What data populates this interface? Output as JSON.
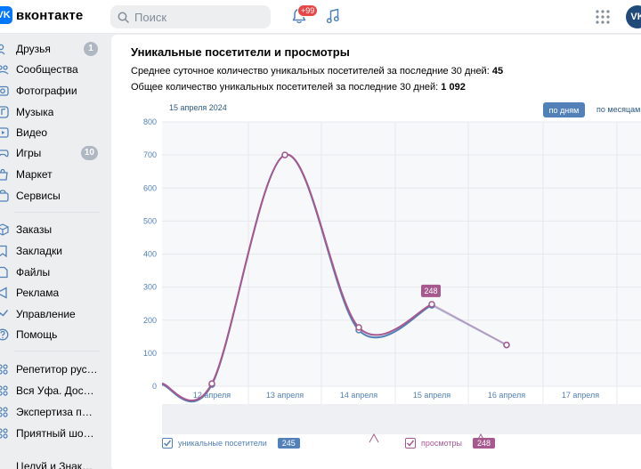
{
  "header": {
    "logo_mark": "VK",
    "logo_text": "вконтакте",
    "search_placeholder": "Поиск",
    "notification_count": "+99",
    "avatar_initials": "VK"
  },
  "sidebar": {
    "items": [
      {
        "label": "Друзья",
        "icon": "friends-icon",
        "count": "1"
      },
      {
        "label": "Сообщества",
        "icon": "communities-icon"
      },
      {
        "label": "Фотографии",
        "icon": "photos-icon"
      },
      {
        "label": "Музыка",
        "icon": "music-icon"
      },
      {
        "label": "Видео",
        "icon": "video-icon"
      },
      {
        "label": "Игры",
        "icon": "games-icon",
        "count": "10"
      },
      {
        "label": "Маркет",
        "icon": "market-icon"
      },
      {
        "label": "Сервисы",
        "icon": "services-icon"
      },
      {
        "label": "Заказы",
        "icon": "orders-icon"
      },
      {
        "label": "Закладки",
        "icon": "bookmarks-icon"
      },
      {
        "label": "Файлы",
        "icon": "files-icon"
      },
      {
        "label": "Реклама",
        "icon": "ads-icon"
      },
      {
        "label": "Управление",
        "icon": "management-icon"
      },
      {
        "label": "Помощь",
        "icon": "help-icon"
      },
      {
        "label": "Репетитор русско...",
        "icon": "app-icon"
      },
      {
        "label": "Вся Уфа. Доска бе...",
        "icon": "app-icon"
      },
      {
        "label": "Экспертиза почер...",
        "icon": "app-icon"
      },
      {
        "label": "Приятный шопинг...",
        "icon": "app-icon"
      },
      {
        "label": "Целуй и Знакомься",
        "icon": "app-icon"
      }
    ]
  },
  "main": {
    "title": "Уникальные посетители и просмотры",
    "stat1_text": "Среднее суточное количество уникальных посетителей за последние 30 дней: ",
    "stat1_value": "45",
    "stat2_text": "Общее количество уникальных посетителей за последние 30 дней: ",
    "stat2_value": "1 092",
    "selected_date": "15 апреля 2024",
    "btn_days": "по дням",
    "btn_months": "по месяцам",
    "tooltip_value": "248",
    "legend": [
      {
        "label": "уникальные посетители",
        "badge": "245",
        "color": "#5181b8"
      },
      {
        "label": "просмотры",
        "badge": "248",
        "color": "#a6588f"
      }
    ]
  },
  "chart_data": {
    "type": "line",
    "ylim": [
      0,
      800
    ],
    "yticks": [
      "0",
      "100",
      "200",
      "300",
      "400",
      "500",
      "600",
      "700",
      "800"
    ],
    "xticks": [
      "12 апреля",
      "13 апреля",
      "14 апреля",
      "15 апреля",
      "16 апреля",
      "17 апреля"
    ],
    "grid": true,
    "legend_position": "bottom",
    "series": [
      {
        "name": "уникальные посетители",
        "color": "#5181b8",
        "points": [
          [
            "11 апреля",
            5
          ],
          [
            "12 апреля",
            5
          ],
          [
            "13 апреля",
            700
          ],
          [
            "14 апреля",
            170
          ],
          [
            "15 апреля",
            245
          ],
          [
            "16 апреля",
            125
          ]
        ]
      },
      {
        "name": "просмотры",
        "color": "#a6588f",
        "points": [
          [
            "11 апреля",
            8
          ],
          [
            "12 апреля",
            8
          ],
          [
            "13 апреля",
            700
          ],
          [
            "14 апреля",
            178
          ],
          [
            "15 апреля",
            248
          ],
          [
            "16 апреля",
            125
          ]
        ]
      }
    ]
  }
}
